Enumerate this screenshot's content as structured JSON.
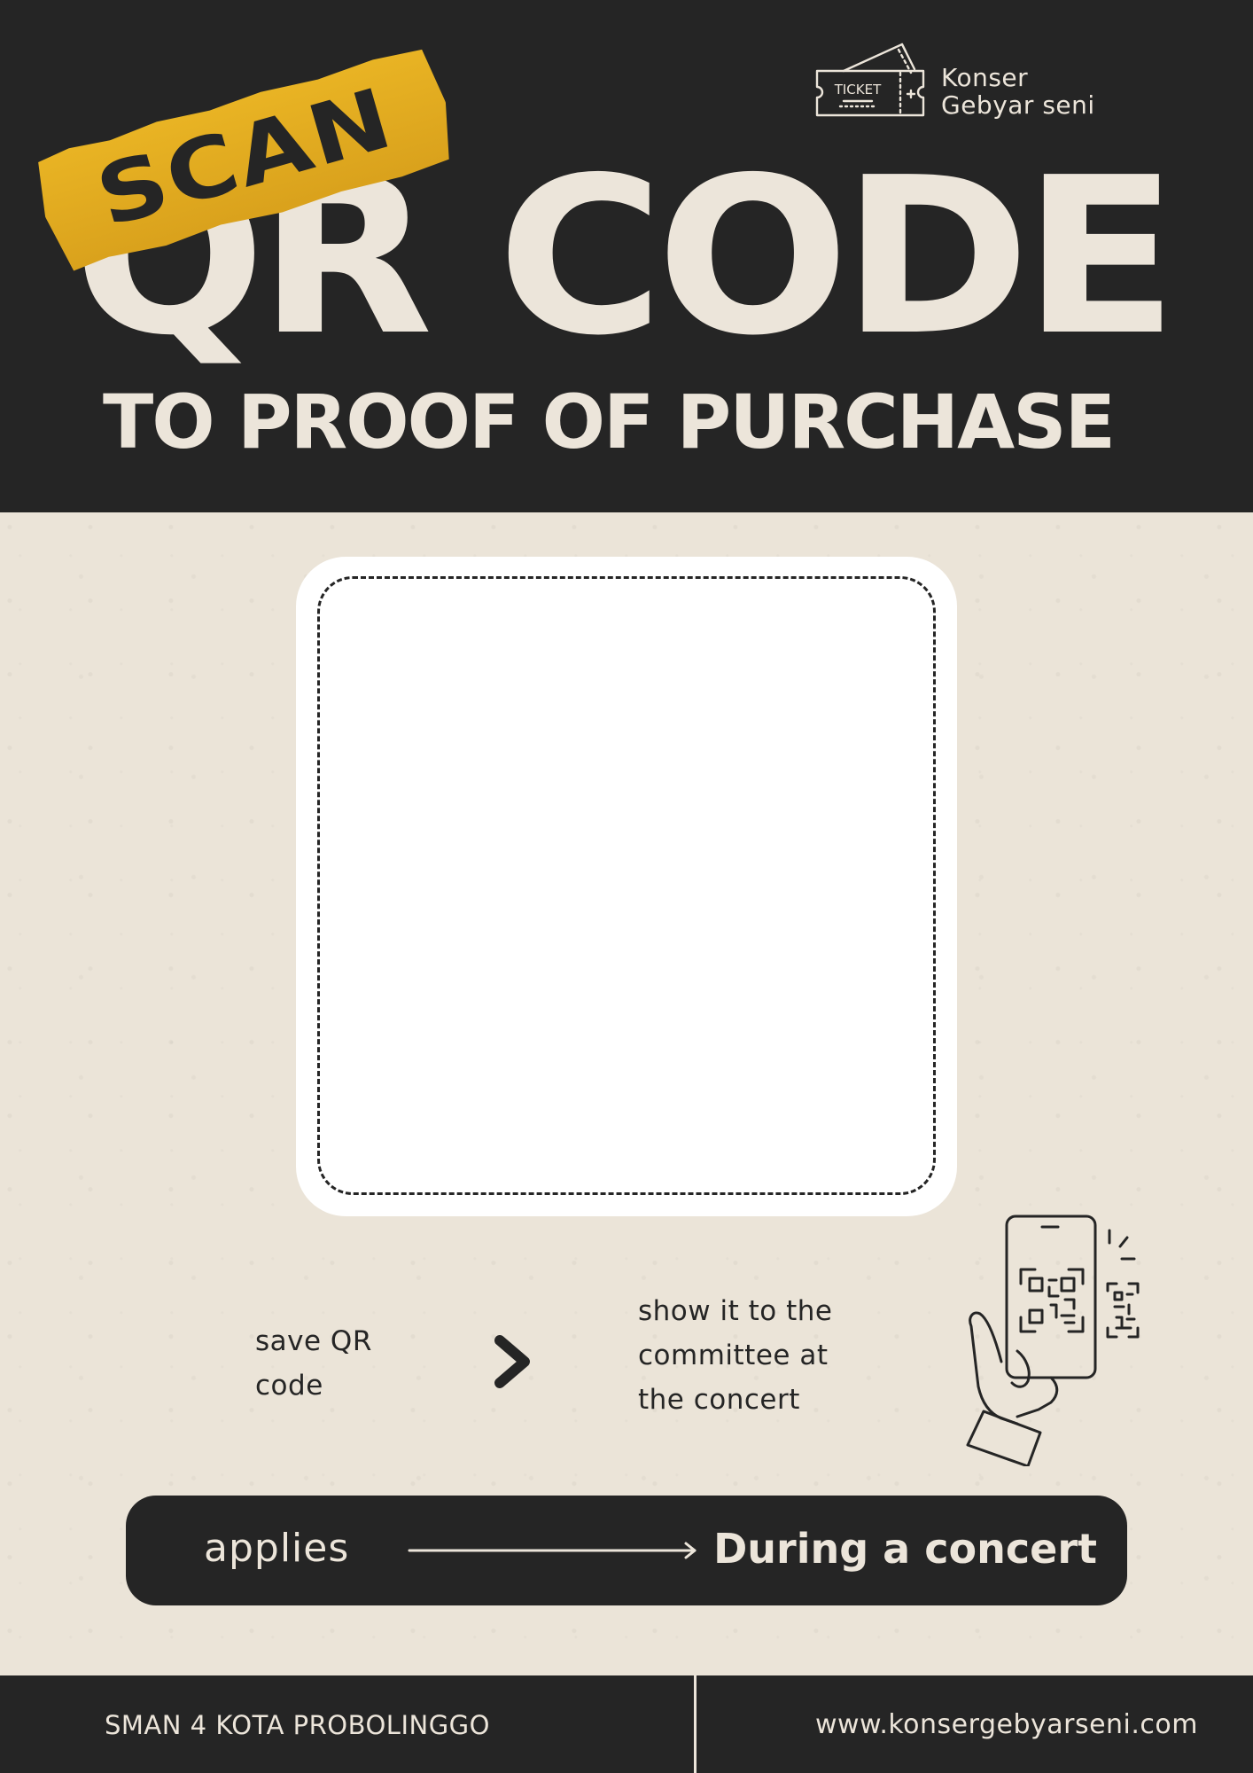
{
  "brand": {
    "ticket_label": "TICKET",
    "name_line1": "Konser",
    "name_line2": "Gebyar seni",
    "icon": "ticket-icon"
  },
  "header": {
    "tape_label": "SCAN",
    "title": "QR CODE",
    "subtitle": "TO PROOF OF PURCHASE"
  },
  "qr_area": {
    "icon": "dashed-qr-placeholder"
  },
  "steps": [
    {
      "line1": "save QR",
      "line2": "code"
    },
    {
      "line1": "show it to the",
      "line2": "committee at",
      "line3": "the concert"
    }
  ],
  "step_separator_icon": "chevron-right-icon",
  "illustration_icon": "hand-holding-phone-qr-icon",
  "applies": {
    "label": "applies",
    "arrow_icon": "long-arrow-right-icon",
    "value": "During a concert"
  },
  "footer": {
    "school": "SMAN 4 KOTA PROBOLINGGO",
    "website": "www.konsergebyarseni.com"
  },
  "colors": {
    "dark": "#252525",
    "cream": "#ece5da",
    "paper": "#ebe4d8",
    "tape_yellow": "#e3ac22",
    "card": "#ffffff"
  }
}
